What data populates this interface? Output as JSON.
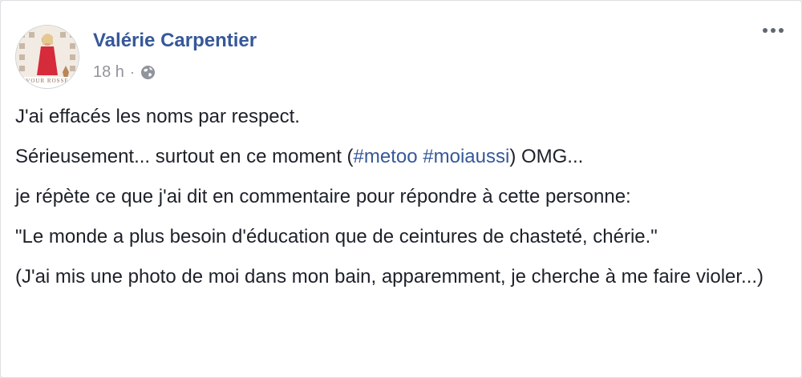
{
  "post": {
    "author": "Valérie Carpentier",
    "timestamp": "18 h",
    "separator": "·",
    "privacy_icon": "globe-icon",
    "avatar_text": "VOUR ROSSE",
    "paragraphs": {
      "p1": "J'ai effacés les noms par respect.",
      "p2_before": "Sérieusement... surtout en ce moment (",
      "p2_tag1": "#metoo",
      "p2_space": " ",
      "p2_tag2": "#moiaussi",
      "p2_after": ") OMG...",
      "p3": "je répète ce que j'ai dit en commentaire pour répondre à cette personne:",
      "p4": "\"Le monde a plus besoin d'éducation que de ceintures de chasteté, chérie.\"",
      "p5": "(J'ai mis une photo de moi dans mon bain, apparemment, je cherche à me faire violer...)"
    }
  },
  "colors": {
    "link": "#365899",
    "text": "#1d2129",
    "meta": "#90949c",
    "border": "#dddfe2"
  }
}
